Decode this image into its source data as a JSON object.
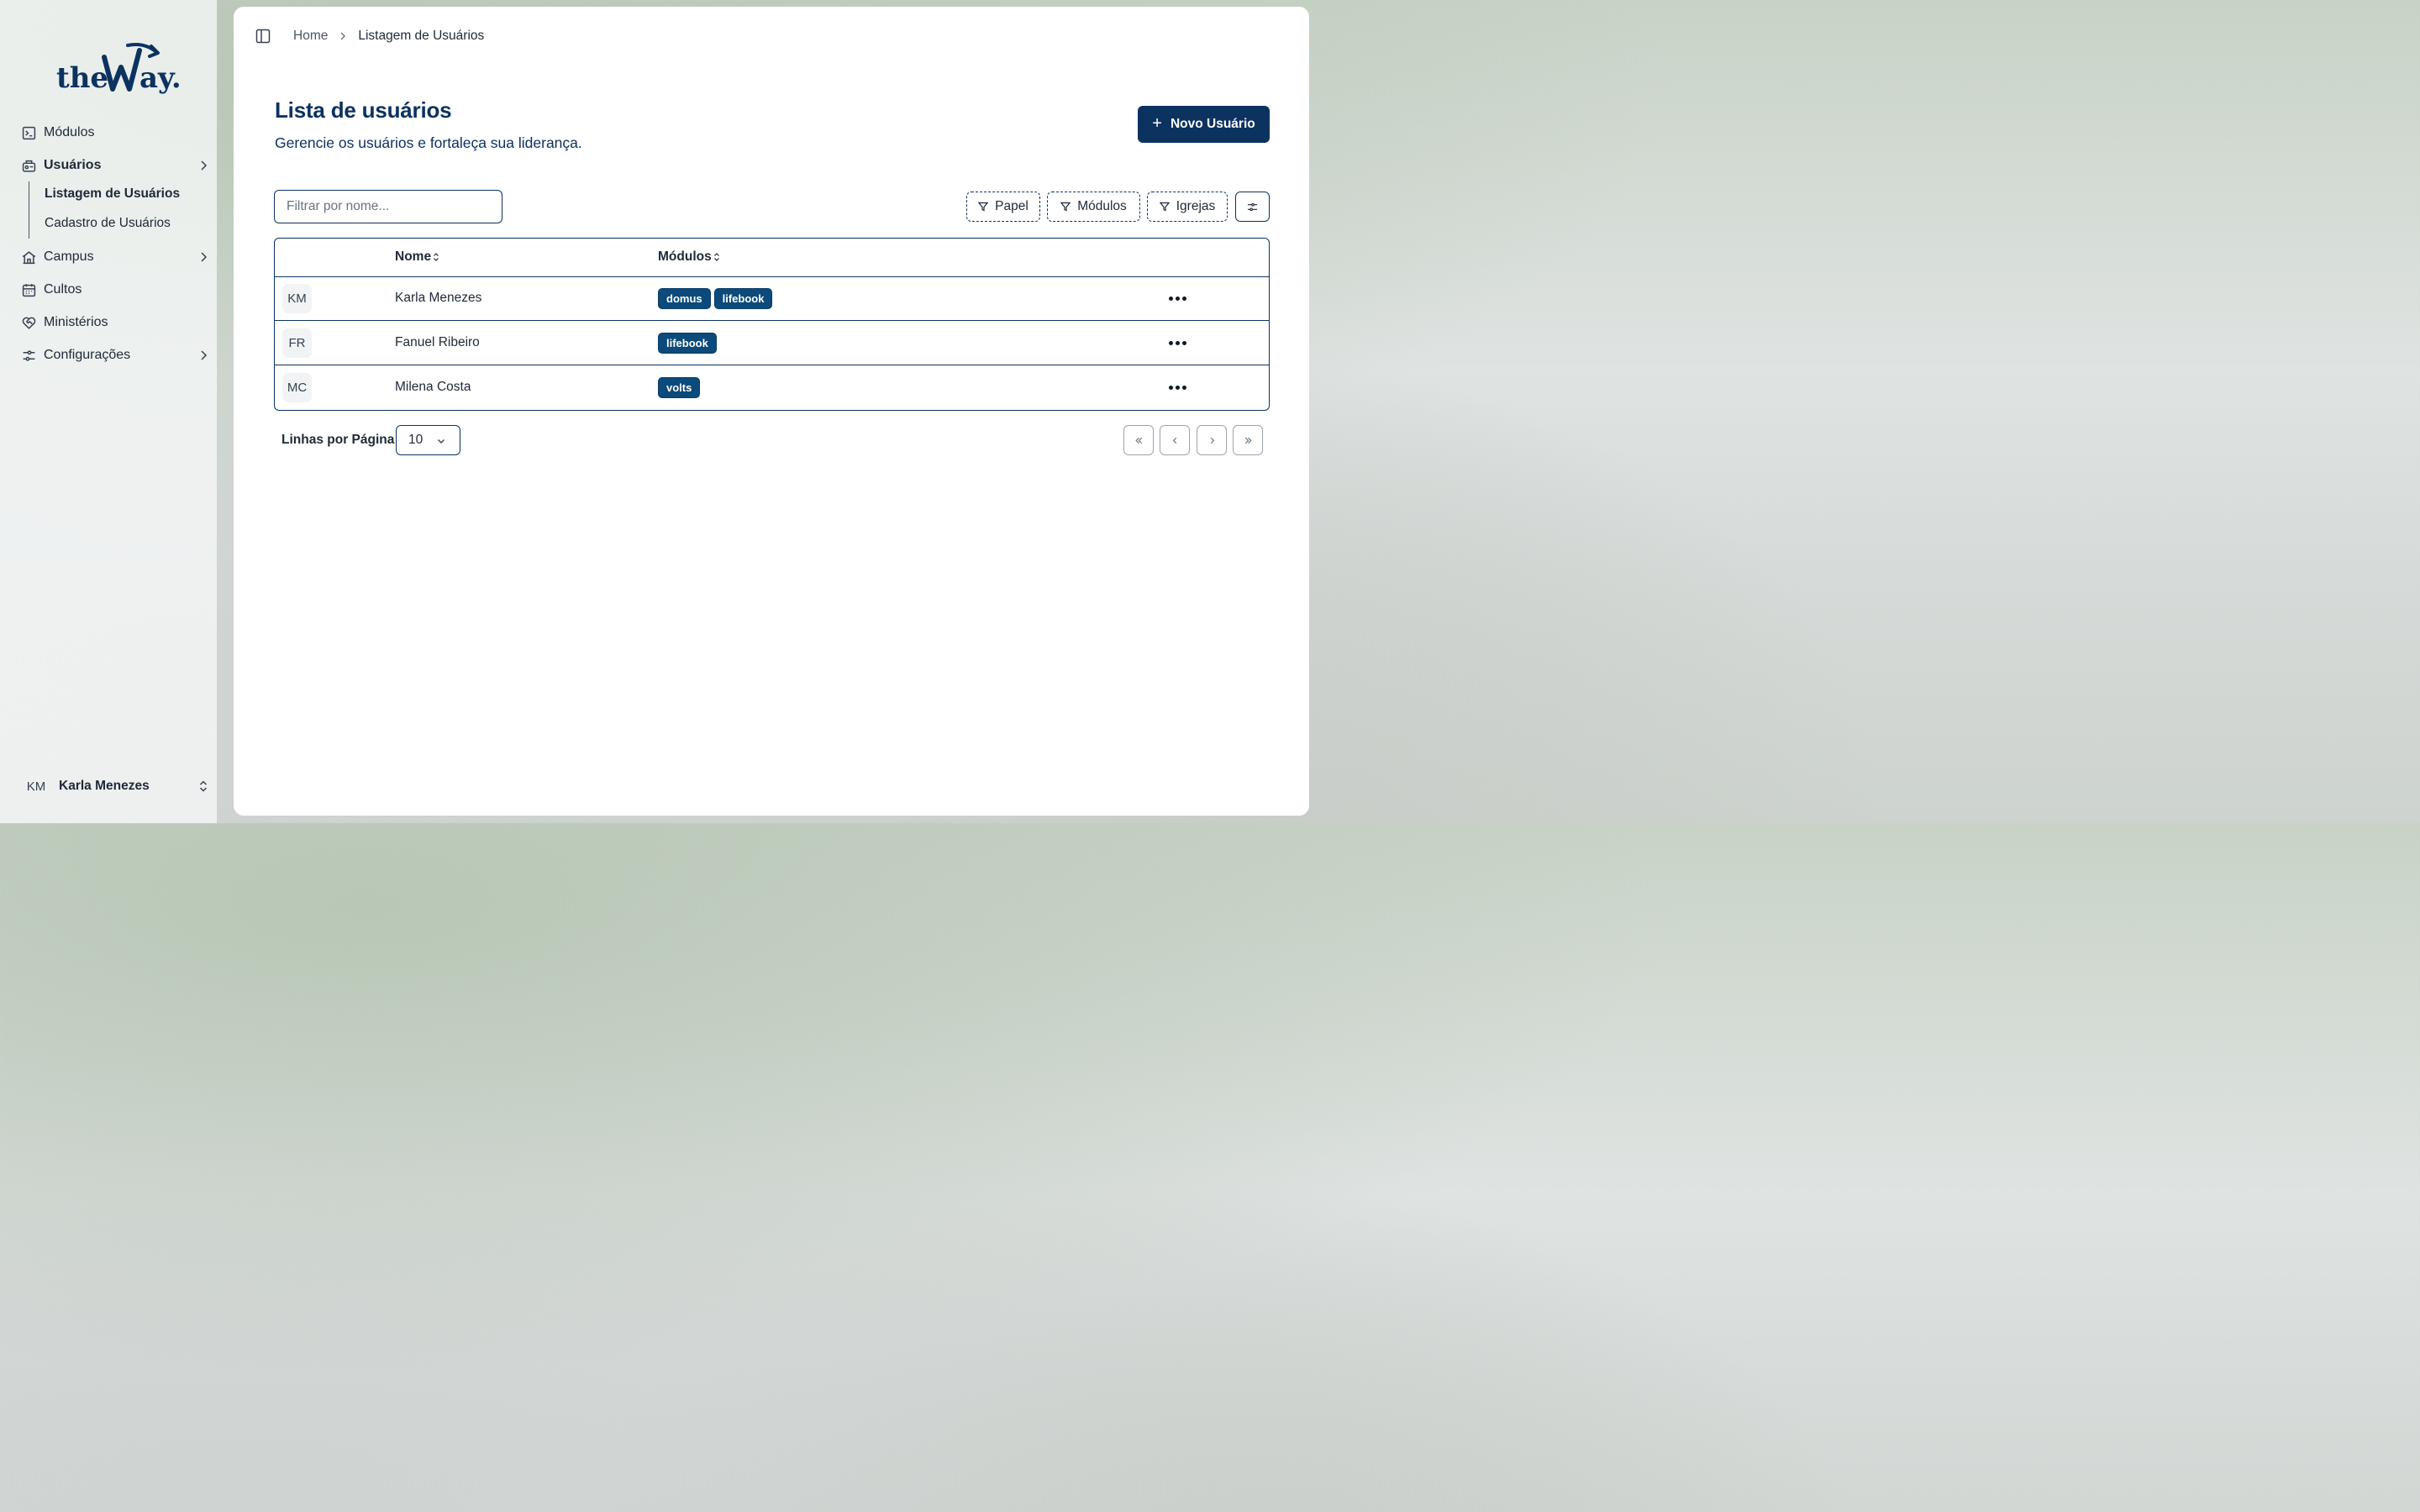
{
  "brand": {
    "logo_text_1": "the",
    "logo_text_2": "ay."
  },
  "sidebar": {
    "items": [
      {
        "label": "Módulos",
        "icon": "modules-icon"
      },
      {
        "label": "Usuários",
        "icon": "users-icon",
        "expanded": true
      },
      {
        "label": "Campus",
        "icon": "campus-icon"
      },
      {
        "label": "Cultos",
        "icon": "calendar-icon"
      },
      {
        "label": "Ministérios",
        "icon": "heart-handshake-icon"
      },
      {
        "label": "Configurações",
        "icon": "settings-sliders-icon"
      }
    ],
    "sub_items": [
      {
        "label": "Listagem de Usuários",
        "active": true
      },
      {
        "label": "Cadastro de Usuários",
        "active": false
      }
    ],
    "user": {
      "initials": "KM",
      "name": "Karla Menezes"
    }
  },
  "header": {
    "breadcrumb_home": "Home",
    "breadcrumb_current": "Listagem de Usuários"
  },
  "page": {
    "title": "Lista de usuários",
    "subtitle": "Gerencie os usuários e fortaleça sua liderança.",
    "new_button": "Novo Usuário",
    "search_placeholder": "Filtrar por nome...",
    "filters": [
      "Papel",
      "Módulos",
      "Igrejas"
    ]
  },
  "table": {
    "columns": [
      "Nome",
      "Módulos"
    ],
    "rows": [
      {
        "initials": "KM",
        "name": "Karla Menezes",
        "modules": [
          "domus",
          "lifebook"
        ]
      },
      {
        "initials": "FR",
        "name": "Fanuel Ribeiro",
        "modules": [
          "lifebook"
        ]
      },
      {
        "initials": "MC",
        "name": "Milena Costa",
        "modules": [
          "volts"
        ]
      }
    ]
  },
  "pagination": {
    "rows_per_page_label": "Linhas por Página",
    "rows_per_page_value": "10"
  },
  "colors": {
    "primary": "#0c3260",
    "badge": "#0b4a7a"
  }
}
